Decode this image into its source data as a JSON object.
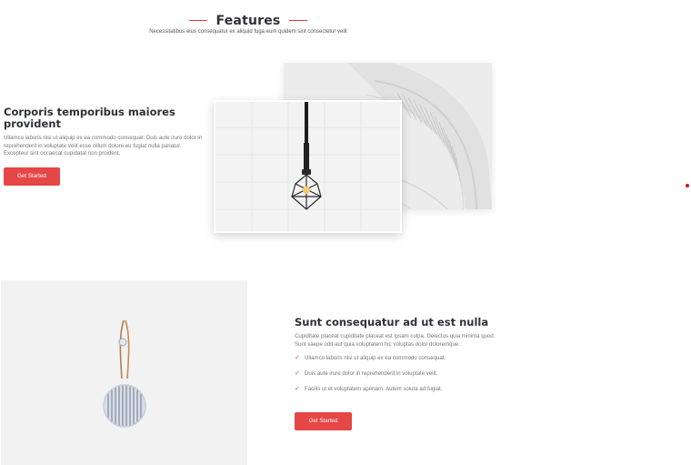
{
  "features": {
    "title": "Features",
    "subtitle": "Necessitatibus eius consequatur ex aliquid fuga eum quidem sint consectetur velit"
  },
  "feature_one": {
    "heading": "Corporis temporibus maiores provident",
    "body": "Ullamco laboris nisi ut aliquip ex ea commodo consequat. Duis aute irure dolor in reprehenderit in voluptate velit esse cillum dolore eu fugiat nulla pariatur. Excepteur sint occaecat cupidatat non proident.",
    "button_label": "Get Started"
  },
  "feature_two": {
    "heading": "Sunt consequatur ad ut est nulla",
    "body": "Cupiditate placeat cupiditate placeat est ipsam culpa. Delectus quia minima quod. Sunt saepe odit aut quia voluptatem hic voluptas dolor doloremque.",
    "list": [
      "Ullamco laboris nisi ut aliquip ex ea commodo consequat.",
      "Duis aute irure dolor in reprehenderit in voluptate velit.",
      "Facilis ut et voluptatem aperiam. Autem soluta ad fugiat."
    ],
    "button_label": "Get Started"
  },
  "colors": {
    "accent": "#e54646",
    "heading": "#2f3138",
    "body_text": "#777777"
  },
  "icons": {
    "list_bullet": "check-icon"
  }
}
